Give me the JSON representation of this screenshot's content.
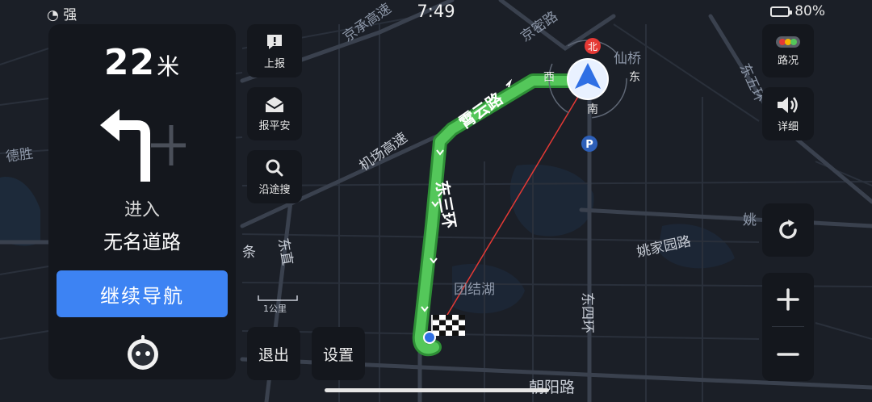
{
  "status": {
    "signal": "强",
    "time": "7:49",
    "battery": "80%"
  },
  "guide": {
    "distance_value": "22",
    "distance_unit": "米",
    "action": "进入",
    "road": "无名道路",
    "continue_label": "继续导航"
  },
  "tools": {
    "report": "上报",
    "safety": "报平安",
    "search_along": "沿途搜",
    "exit": "退出",
    "settings": "设置"
  },
  "right": {
    "traffic": "路况",
    "detail": "详细"
  },
  "compass": {
    "west": "西",
    "east": "东",
    "south": "南",
    "north": "北"
  },
  "map_labels": {
    "jingcheng": "京承高速",
    "jingmi": "京密路",
    "xianqiao": "仙桥",
    "dongwu": "东五环",
    "jichang": "机场高速",
    "xiayun": "霄云路",
    "dongsan": "东三环",
    "dongsi": "东四环",
    "dongzhi": "东直",
    "yaojia": "姚家园路",
    "tuanjiehu": "团结湖",
    "chaoyang": "朝阳路",
    "deshengmen": "德胜",
    "scale": "1公里",
    "yitiao": "条",
    "yao": "姚"
  },
  "colors": {
    "accent": "#3d83f3",
    "route": "#54c75a",
    "panel": "#14171d",
    "map_bg": "#1b1f27"
  },
  "icons": {
    "turn": "turn-left-icon",
    "assistant": "robot-assistant-icon",
    "report": "report-exclamation-icon",
    "safety": "mail-icon",
    "search": "search-icon",
    "traffic": "traffic-light-icon",
    "volume": "speaker-icon",
    "refresh": "refresh-icon",
    "zoom_in": "plus-icon",
    "zoom_out": "minus-icon"
  }
}
